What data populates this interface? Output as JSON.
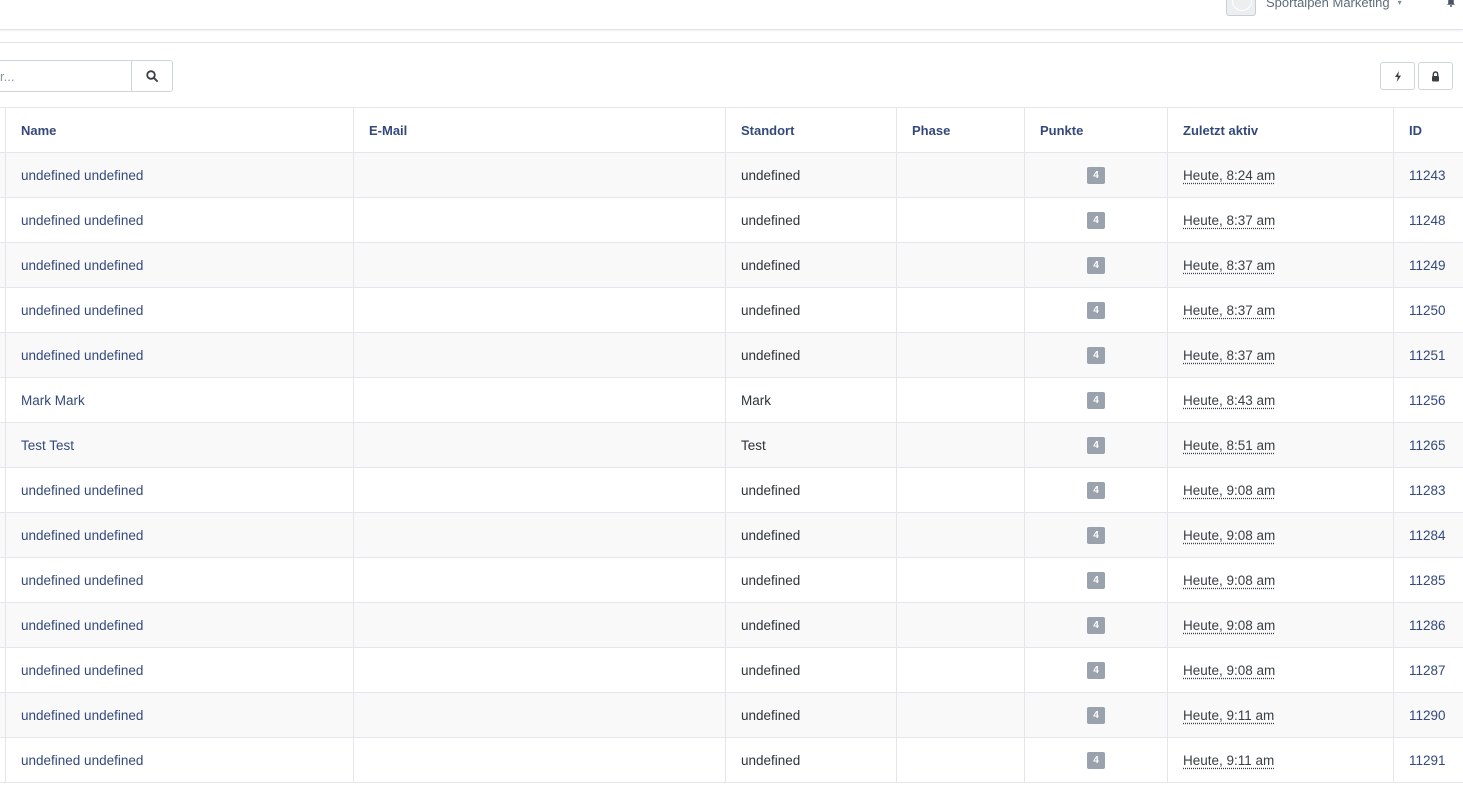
{
  "header": {
    "account_name": "Sportalpen Marketing",
    "caret": "▾"
  },
  "toolbar": {
    "search_placeholder": "r..."
  },
  "table": {
    "columns": [
      "Name",
      "E-Mail",
      "Standort",
      "Phase",
      "Punkte",
      "Zuletzt aktiv",
      "ID"
    ],
    "rows": [
      {
        "name": "undefined undefined",
        "email": "",
        "standort": "undefined",
        "phase": "",
        "punkte": "4",
        "zuletzt": "Heute, 8:24 am",
        "id": "11243"
      },
      {
        "name": "undefined undefined",
        "email": "",
        "standort": "undefined",
        "phase": "",
        "punkte": "4",
        "zuletzt": "Heute, 8:37 am",
        "id": "11248"
      },
      {
        "name": "undefined undefined",
        "email": "",
        "standort": "undefined",
        "phase": "",
        "punkte": "4",
        "zuletzt": "Heute, 8:37 am",
        "id": "11249"
      },
      {
        "name": "undefined undefined",
        "email": "",
        "standort": "undefined",
        "phase": "",
        "punkte": "4",
        "zuletzt": "Heute, 8:37 am",
        "id": "11250"
      },
      {
        "name": "undefined undefined",
        "email": "",
        "standort": "undefined",
        "phase": "",
        "punkte": "4",
        "zuletzt": "Heute, 8:37 am",
        "id": "11251"
      },
      {
        "name": "Mark Mark",
        "email": "",
        "standort": "Mark",
        "phase": "",
        "punkte": "4",
        "zuletzt": "Heute, 8:43 am",
        "id": "11256"
      },
      {
        "name": "Test Test",
        "email": "",
        "standort": "Test",
        "phase": "",
        "punkte": "4",
        "zuletzt": "Heute, 8:51 am",
        "id": "11265"
      },
      {
        "name": "undefined undefined",
        "email": "",
        "standort": "undefined",
        "phase": "",
        "punkte": "4",
        "zuletzt": "Heute, 9:08 am",
        "id": "11283"
      },
      {
        "name": "undefined undefined",
        "email": "",
        "standort": "undefined",
        "phase": "",
        "punkte": "4",
        "zuletzt": "Heute, 9:08 am",
        "id": "11284"
      },
      {
        "name": "undefined undefined",
        "email": "",
        "standort": "undefined",
        "phase": "",
        "punkte": "4",
        "zuletzt": "Heute, 9:08 am",
        "id": "11285"
      },
      {
        "name": "undefined undefined",
        "email": "",
        "standort": "undefined",
        "phase": "",
        "punkte": "4",
        "zuletzt": "Heute, 9:08 am",
        "id": "11286"
      },
      {
        "name": "undefined undefined",
        "email": "",
        "standort": "undefined",
        "phase": "",
        "punkte": "4",
        "zuletzt": "Heute, 9:08 am",
        "id": "11287"
      },
      {
        "name": "undefined undefined",
        "email": "",
        "standort": "undefined",
        "phase": "",
        "punkte": "4",
        "zuletzt": "Heute, 9:11 am",
        "id": "11290"
      },
      {
        "name": "undefined undefined",
        "email": "",
        "standort": "undefined",
        "phase": "",
        "punkte": "4",
        "zuletzt": "Heute, 9:11 am",
        "id": "11291"
      }
    ]
  }
}
